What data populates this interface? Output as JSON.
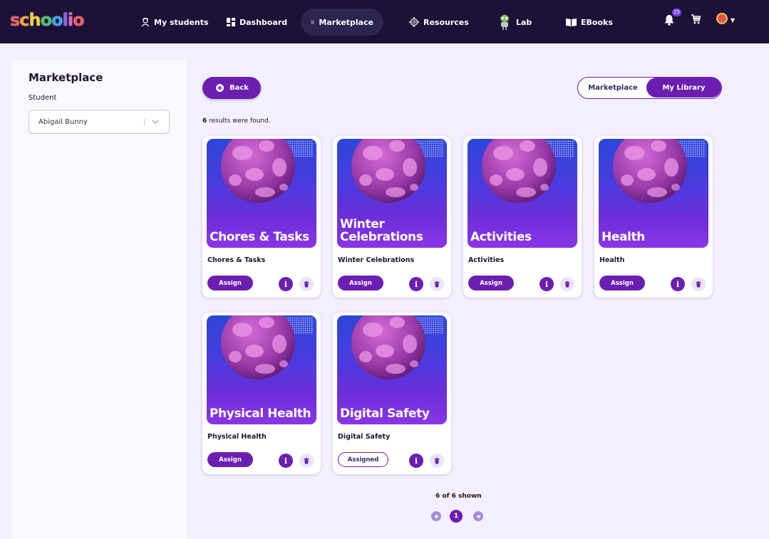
{
  "app": {
    "logo": "schoolio",
    "logo_colors": [
      "#f25a5a",
      "#f7a833",
      "#f3d23a",
      "#4fc16c",
      "#3da2f0",
      "#8a63e8",
      "#e266c7",
      "#f25a5a"
    ]
  },
  "nav": {
    "items": [
      {
        "label": "My students",
        "icon": "student-icon"
      },
      {
        "label": "Dashboard",
        "icon": "dashboard-icon"
      },
      {
        "label": "Marketplace",
        "icon": "marketplace-icon",
        "active": true
      },
      {
        "label": "Resources",
        "icon": "gear-icon"
      },
      {
        "label": "Lab",
        "icon": "robot-icon"
      },
      {
        "label": "EBooks",
        "icon": "book-icon"
      }
    ],
    "notifications_count": "25"
  },
  "sidebar": {
    "title": "Marketplace",
    "student_label": "Student",
    "student_value": "Abigail Bunny"
  },
  "main": {
    "back_label": "Back",
    "toggle": {
      "option1": "Marketplace",
      "option2": "My Library",
      "selected": "My Library"
    },
    "results_count": "6",
    "results_text": " results were found.",
    "cards": [
      {
        "cover": "Chores & Tasks",
        "name": "Chores & Tasks",
        "action": "Assign"
      },
      {
        "cover": "Winter Celebrations",
        "name": "Winter Celebrations",
        "action": "Assign"
      },
      {
        "cover": "Activities",
        "name": "Activities",
        "action": "Assign"
      },
      {
        "cover": "Health",
        "name": "Health",
        "action": "Assign"
      },
      {
        "cover": "Physical Health",
        "name": "Physical Health",
        "action": "Assign"
      },
      {
        "cover": "Digital Safety",
        "name": "Digital Safety",
        "action": "Assigned"
      }
    ],
    "info_label": "i",
    "shown_text": "6 of 6 shown",
    "current_page": "1"
  },
  "colors": {
    "nav_bg": "#1c1238",
    "accent": "#6b1fb0",
    "page_bg": "#f4effc"
  }
}
